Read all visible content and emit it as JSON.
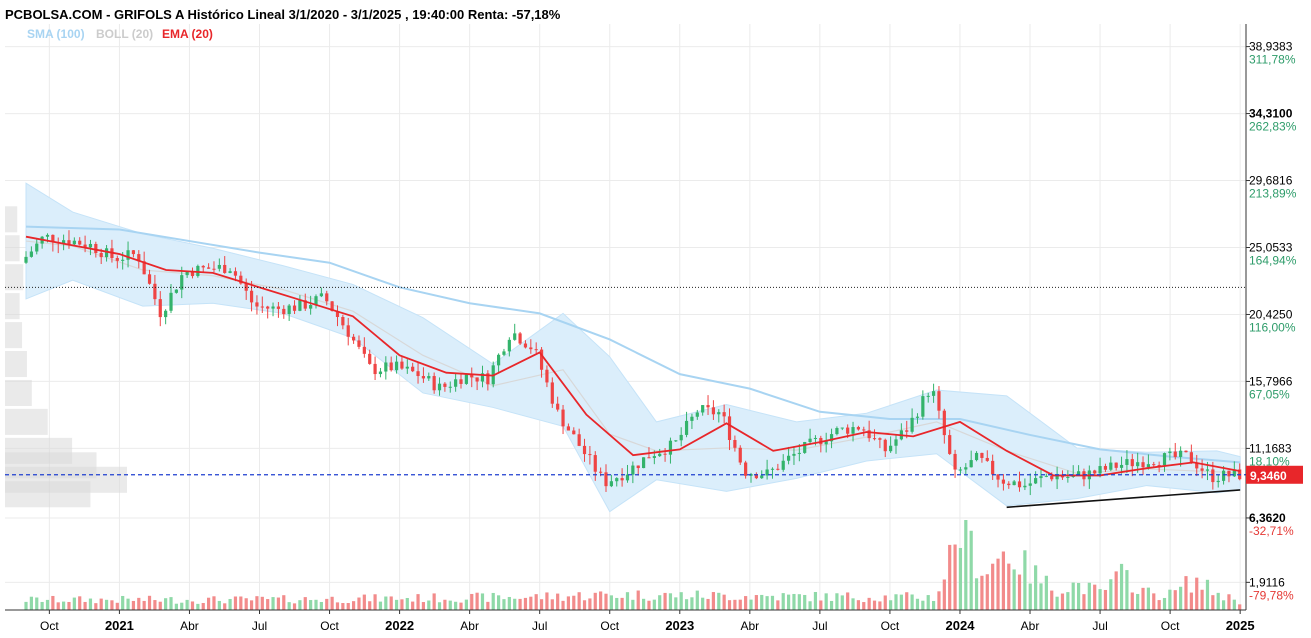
{
  "header": {
    "title": "PCBOLSA.COM - GRIFOLS A Histórico Lineal 3/1/2020 - 3/1/2025 , 19:40:00 Renta: -57,18%"
  },
  "legend": [
    {
      "label": "SMA (100)",
      "color": "#a8d4f2"
    },
    {
      "label": "BOLL (20)",
      "color": "#cccccc"
    },
    {
      "label": "EMA (20)",
      "color": "#e8262a"
    }
  ],
  "colors": {
    "up": "#33b36b",
    "down": "#ef4444",
    "ema": "#e8262a",
    "sma": "#a8d4f2",
    "boll_fill": "#dbeefb",
    "boll_mid": "#d8d8d8",
    "current_line": "#1f3fd0",
    "pct_positive": "#2e9c6a",
    "pct_negative": "#e53935",
    "volume_up": "#8fd9a8",
    "volume_down": "#f28b8b"
  },
  "chart_data": {
    "type": "candlestick",
    "title": "PCBOLSA.COM - GRIFOLS A Histórico Lineal 3/1/2020 - 3/1/2025 , 19:40:00 Renta: -57,18%",
    "x_range": [
      "2020-09",
      "2025-01"
    ],
    "ylim": [
      0,
      40.5
    ],
    "grid": true,
    "price_levels": [
      {
        "price": "38,9383",
        "pct": "311,78%"
      },
      {
        "price": "34,3100",
        "pct": "262,83%",
        "bold": true
      },
      {
        "price": "29,6816",
        "pct": "213,89%"
      },
      {
        "price": "25,0533",
        "pct": "164,94%"
      },
      {
        "price": "20,4250",
        "pct": "116,00%"
      },
      {
        "price": "15,7966",
        "pct": "67,05%"
      },
      {
        "price": "11,1683",
        "pct": "18,10%"
      },
      {
        "price": "6,3620",
        "pct": "-32,71%",
        "bold": true
      },
      {
        "price": "1,9116",
        "pct": "-79,78%"
      }
    ],
    "last_price": {
      "label": "9,3460",
      "value": 9.346
    },
    "reference_line": 22.3,
    "x_labels": [
      {
        "text": "Oct",
        "date": "2020-10"
      },
      {
        "text": "2021",
        "date": "2021-01",
        "year": true
      },
      {
        "text": "Abr",
        "date": "2021-04"
      },
      {
        "text": "Jul",
        "date": "2021-07"
      },
      {
        "text": "Oct",
        "date": "2021-10"
      },
      {
        "text": "2022",
        "date": "2022-01",
        "year": true
      },
      {
        "text": "Abr",
        "date": "2022-04"
      },
      {
        "text": "Jul",
        "date": "2022-07"
      },
      {
        "text": "Oct",
        "date": "2022-10"
      },
      {
        "text": "2023",
        "date": "2023-01",
        "year": true
      },
      {
        "text": "Abr",
        "date": "2023-04"
      },
      {
        "text": "Jul",
        "date": "2023-07"
      },
      {
        "text": "Oct",
        "date": "2023-10"
      },
      {
        "text": "2024",
        "date": "2024-01",
        "year": true
      },
      {
        "text": "Abr",
        "date": "2024-04"
      },
      {
        "text": "Jul",
        "date": "2024-07"
      },
      {
        "text": "Oct",
        "date": "2024-10"
      },
      {
        "text": "2025",
        "date": "2025-01",
        "year": true
      }
    ],
    "close_trend": [
      {
        "date": "2020-09",
        "value": 24.0
      },
      {
        "date": "2020-10",
        "value": 25.8
      },
      {
        "date": "2020-11",
        "value": 25.6
      },
      {
        "date": "2020-12",
        "value": 25.2
      },
      {
        "date": "2021-01",
        "value": 24.3
      },
      {
        "date": "2021-02",
        "value": 24.6
      },
      {
        "date": "2021-03",
        "value": 20.5
      },
      {
        "date": "2021-04",
        "value": 23.4
      },
      {
        "date": "2021-05",
        "value": 23.6
      },
      {
        "date": "2021-06",
        "value": 23.7
      },
      {
        "date": "2021-07",
        "value": 21.0
      },
      {
        "date": "2021-08",
        "value": 20.8
      },
      {
        "date": "2021-09",
        "value": 21.0
      },
      {
        "date": "2021-10",
        "value": 21.6
      },
      {
        "date": "2021-11",
        "value": 19.3
      },
      {
        "date": "2021-12",
        "value": 16.6
      },
      {
        "date": "2022-01",
        "value": 16.8
      },
      {
        "date": "2022-02",
        "value": 16.3
      },
      {
        "date": "2022-03",
        "value": 15.3
      },
      {
        "date": "2022-04",
        "value": 16.2
      },
      {
        "date": "2022-05",
        "value": 16.0
      },
      {
        "date": "2022-06",
        "value": 19.3
      },
      {
        "date": "2022-07",
        "value": 18.0
      },
      {
        "date": "2022-08",
        "value": 13.6
      },
      {
        "date": "2022-09",
        "value": 11.2
      },
      {
        "date": "2022-10",
        "value": 8.8
      },
      {
        "date": "2022-11",
        "value": 9.6
      },
      {
        "date": "2022-12",
        "value": 10.8
      },
      {
        "date": "2023-01",
        "value": 11.4
      },
      {
        "date": "2023-02",
        "value": 13.8
      },
      {
        "date": "2023-03",
        "value": 13.6
      },
      {
        "date": "2023-04",
        "value": 9.6
      },
      {
        "date": "2023-05",
        "value": 9.4
      },
      {
        "date": "2023-06",
        "value": 10.6
      },
      {
        "date": "2023-07",
        "value": 11.6
      },
      {
        "date": "2023-08",
        "value": 12.4
      },
      {
        "date": "2023-09",
        "value": 12.7
      },
      {
        "date": "2023-10",
        "value": 11.0
      },
      {
        "date": "2023-11",
        "value": 12.6
      },
      {
        "date": "2023-12",
        "value": 15.5
      },
      {
        "date": "2024-01",
        "value": 9.3
      },
      {
        "date": "2024-02",
        "value": 10.5
      },
      {
        "date": "2024-03",
        "value": 9.0
      },
      {
        "date": "2024-04",
        "value": 8.6
      },
      {
        "date": "2024-05",
        "value": 9.3
      },
      {
        "date": "2024-06",
        "value": 9.2
      },
      {
        "date": "2024-07",
        "value": 9.5
      },
      {
        "date": "2024-08",
        "value": 10.0
      },
      {
        "date": "2024-09",
        "value": 10.3
      },
      {
        "date": "2024-10",
        "value": 10.5
      },
      {
        "date": "2024-11",
        "value": 10.6
      },
      {
        "date": "2024-12",
        "value": 9.2
      },
      {
        "date": "2025-01",
        "value": 9.35
      }
    ],
    "series": [
      {
        "name": "EMA (20)",
        "color": "#e8262a",
        "points": [
          {
            "date": "2020-09",
            "value": 25.8
          },
          {
            "date": "2020-11",
            "value": 25.2
          },
          {
            "date": "2021-01",
            "value": 24.6
          },
          {
            "date": "2021-03",
            "value": 23.5
          },
          {
            "date": "2021-05",
            "value": 23.3
          },
          {
            "date": "2021-07",
            "value": 22.3
          },
          {
            "date": "2021-09",
            "value": 21.3
          },
          {
            "date": "2021-11",
            "value": 20.3
          },
          {
            "date": "2022-01",
            "value": 17.6
          },
          {
            "date": "2022-03",
            "value": 16.4
          },
          {
            "date": "2022-05",
            "value": 16.2
          },
          {
            "date": "2022-07",
            "value": 17.8
          },
          {
            "date": "2022-09",
            "value": 13.5
          },
          {
            "date": "2022-11",
            "value": 10.7
          },
          {
            "date": "2023-01",
            "value": 11.1
          },
          {
            "date": "2023-03",
            "value": 12.9
          },
          {
            "date": "2023-05",
            "value": 11.0
          },
          {
            "date": "2023-07",
            "value": 11.6
          },
          {
            "date": "2023-09",
            "value": 12.3
          },
          {
            "date": "2023-11",
            "value": 12.0
          },
          {
            "date": "2024-01",
            "value": 13.0
          },
          {
            "date": "2024-03",
            "value": 11.0
          },
          {
            "date": "2024-05",
            "value": 9.3
          },
          {
            "date": "2024-07",
            "value": 9.3
          },
          {
            "date": "2024-09",
            "value": 9.8
          },
          {
            "date": "2024-11",
            "value": 10.2
          },
          {
            "date": "2025-01",
            "value": 9.6
          }
        ]
      },
      {
        "name": "SMA (100)",
        "color": "#a8d4f2",
        "points": [
          {
            "date": "2020-09",
            "value": 26.5
          },
          {
            "date": "2021-01",
            "value": 26.3
          },
          {
            "date": "2021-07",
            "value": 24.7
          },
          {
            "date": "2021-10",
            "value": 24.0
          },
          {
            "date": "2022-01",
            "value": 22.3
          },
          {
            "date": "2022-04",
            "value": 21.2
          },
          {
            "date": "2022-07",
            "value": 20.5
          },
          {
            "date": "2022-10",
            "value": 18.7
          },
          {
            "date": "2023-01",
            "value": 16.3
          },
          {
            "date": "2023-04",
            "value": 15.3
          },
          {
            "date": "2023-07",
            "value": 13.7
          },
          {
            "date": "2023-10",
            "value": 13.2
          },
          {
            "date": "2024-01",
            "value": 13.2
          },
          {
            "date": "2024-04",
            "value": 12.1
          },
          {
            "date": "2024-07",
            "value": 11.1
          },
          {
            "date": "2024-10",
            "value": 10.6
          },
          {
            "date": "2025-01",
            "value": 10.2
          }
        ]
      },
      {
        "name": "BOLL (20)",
        "color": "#cccccc",
        "upper": [
          {
            "date": "2020-09",
            "value": 29.5
          },
          {
            "date": "2020-11",
            "value": 27.5
          },
          {
            "date": "2021-02",
            "value": 26.0
          },
          {
            "date": "2021-05",
            "value": 25.0
          },
          {
            "date": "2021-08",
            "value": 23.8
          },
          {
            "date": "2021-11",
            "value": 22.5
          },
          {
            "date": "2022-02",
            "value": 20.2
          },
          {
            "date": "2022-05",
            "value": 17.0
          },
          {
            "date": "2022-08",
            "value": 20.5
          },
          {
            "date": "2022-10",
            "value": 17.5
          },
          {
            "date": "2022-12",
            "value": 13.0
          },
          {
            "date": "2023-03",
            "value": 14.2
          },
          {
            "date": "2023-06",
            "value": 13.0
          },
          {
            "date": "2023-09",
            "value": 13.6
          },
          {
            "date": "2023-12",
            "value": 15.2
          },
          {
            "date": "2024-03",
            "value": 14.8
          },
          {
            "date": "2024-06",
            "value": 11.2
          },
          {
            "date": "2024-09",
            "value": 10.9
          },
          {
            "date": "2024-12",
            "value": 11.0
          },
          {
            "date": "2025-01",
            "value": 10.6
          }
        ],
        "lower": [
          {
            "date": "2020-09",
            "value": 21.5
          },
          {
            "date": "2020-11",
            "value": 22.8
          },
          {
            "date": "2021-02",
            "value": 21.0
          },
          {
            "date": "2021-05",
            "value": 21.2
          },
          {
            "date": "2021-08",
            "value": 20.5
          },
          {
            "date": "2021-11",
            "value": 18.8
          },
          {
            "date": "2022-02",
            "value": 15.0
          },
          {
            "date": "2022-05",
            "value": 14.0
          },
          {
            "date": "2022-08",
            "value": 12.7
          },
          {
            "date": "2022-10",
            "value": 6.8
          },
          {
            "date": "2022-12",
            "value": 9.0
          },
          {
            "date": "2023-03",
            "value": 8.2
          },
          {
            "date": "2023-06",
            "value": 9.1
          },
          {
            "date": "2023-09",
            "value": 10.3
          },
          {
            "date": "2023-12",
            "value": 10.8
          },
          {
            "date": "2024-03",
            "value": 7.2
          },
          {
            "date": "2024-06",
            "value": 7.7
          },
          {
            "date": "2024-09",
            "value": 8.6
          },
          {
            "date": "2024-12",
            "value": 8.1
          },
          {
            "date": "2025-01",
            "value": 8.3
          }
        ]
      }
    ],
    "support_trendline": [
      {
        "date": "2024-03",
        "value": 7.1
      },
      {
        "date": "2025-01",
        "value": 8.3
      }
    ],
    "volume_profile": [
      {
        "price": 27.0,
        "weight": 0.1
      },
      {
        "price": 25.0,
        "weight": 0.12
      },
      {
        "price": 23.0,
        "weight": 0.15
      },
      {
        "price": 21.0,
        "weight": 0.12
      },
      {
        "price": 19.0,
        "weight": 0.14
      },
      {
        "price": 17.0,
        "weight": 0.18
      },
      {
        "price": 15.0,
        "weight": 0.22
      },
      {
        "price": 13.0,
        "weight": 0.35
      },
      {
        "price": 11.0,
        "weight": 0.55
      },
      {
        "price": 10.0,
        "weight": 0.75
      },
      {
        "price": 9.0,
        "weight": 1.0
      },
      {
        "price": 8.0,
        "weight": 0.7
      }
    ],
    "volume_trend": [
      {
        "date": "2020-09",
        "value": 0.12
      },
      {
        "date": "2021-06",
        "value": 0.12
      },
      {
        "date": "2022-06",
        "value": 0.15
      },
      {
        "date": "2022-10",
        "value": 0.18
      },
      {
        "date": "2023-06",
        "value": 0.16
      },
      {
        "date": "2023-12",
        "value": 0.15
      },
      {
        "date": "2024-01",
        "value": 1.0
      },
      {
        "date": "2024-02",
        "value": 0.45
      },
      {
        "date": "2024-03",
        "value": 0.7
      },
      {
        "date": "2024-04",
        "value": 0.45
      },
      {
        "date": "2024-05",
        "value": 0.25
      },
      {
        "date": "2024-06",
        "value": 0.3
      },
      {
        "date": "2024-07",
        "value": 0.2
      },
      {
        "date": "2024-08",
        "value": 0.42
      },
      {
        "date": "2024-09",
        "value": 0.2
      },
      {
        "date": "2024-10",
        "value": 0.18
      },
      {
        "date": "2024-11",
        "value": 0.35
      },
      {
        "date": "2024-12",
        "value": 0.2
      },
      {
        "date": "2025-01",
        "value": 0.1
      }
    ]
  }
}
